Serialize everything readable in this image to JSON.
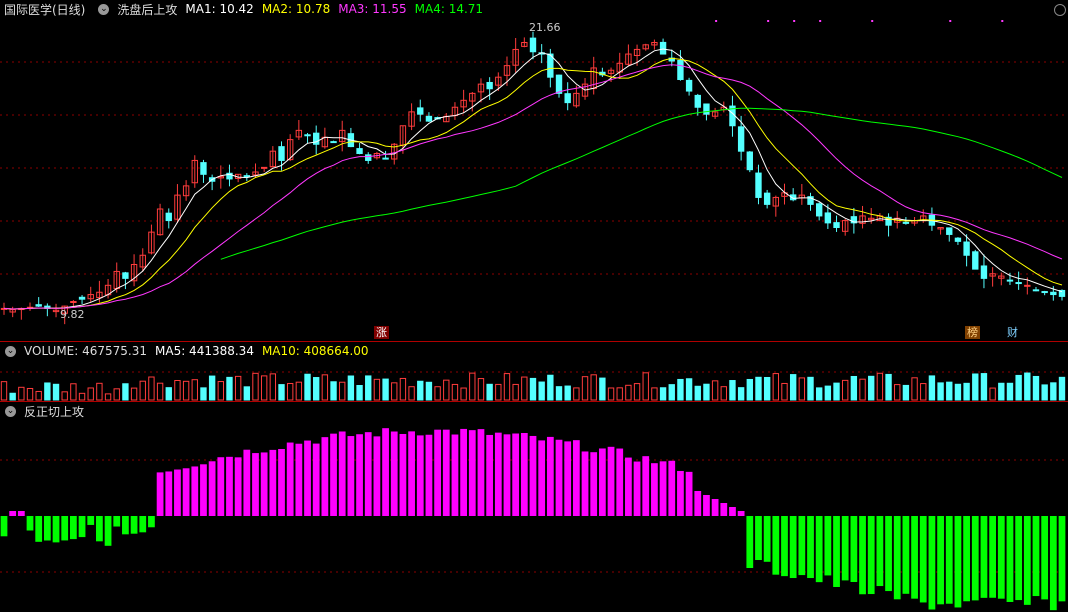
{
  "main_header": {
    "stock": "国际医学(日线)",
    "indicator": "洗盘后上攻",
    "ma1": "MA1: 10.42",
    "ma2": "MA2: 10.78",
    "ma3": "MA3: 11.55",
    "ma4": "MA4: 14.71"
  },
  "main_annotations": {
    "high": "21.66",
    "low": "9.82"
  },
  "markers": {
    "zhang": "涨",
    "bang": "榜",
    "cai": "财"
  },
  "volume_header": {
    "volume": "VOLUME: 467575.31",
    "ma5": "MA5: 441388.34",
    "ma10": "MA10: 408664.00"
  },
  "oscillator_header": {
    "name": "反正切上攻"
  },
  "colors": {
    "up": "#ff3c3c",
    "down": "#54ffff",
    "ma1": "#ffffff",
    "ma2": "#ffff00",
    "ma3": "#ff38ff",
    "ma4": "#00ff00",
    "pos": "#ff00ff",
    "neg": "#00ff00",
    "grid": "#8b0000"
  },
  "chart_data": {
    "type": "candlestick",
    "title": "国际医学(日线)",
    "price_anchors": {
      "high": 21.66,
      "low": 9.82
    },
    "close_path": [
      9.9,
      9.85,
      9.9,
      9.95,
      10.0,
      9.9,
      9.82,
      10.0,
      10.2,
      10.3,
      10.5,
      10.6,
      10.9,
      11.5,
      11.2,
      11.8,
      12.2,
      13.2,
      14.2,
      13.7,
      14.8,
      15.2,
      16.3,
      15.7,
      15.4,
      15.6,
      15.5,
      15.7,
      15.6,
      15.8,
      16.0,
      16.7,
      16.3,
      17.2,
      17.6,
      17.4,
      17.0,
      17.3,
      17.1,
      17.6,
      16.9,
      16.6,
      16.3,
      16.6,
      16.4,
      17.0,
      17.8,
      18.4,
      18.3,
      18.0,
      18.1,
      18.2,
      18.6,
      18.9,
      19.2,
      19.6,
      19.4,
      19.9,
      20.4,
      21.1,
      21.4,
      21.0,
      20.9,
      19.9,
      19.2,
      18.8,
      19.2,
      19.6,
      20.3,
      20.0,
      20.2,
      20.5,
      20.9,
      21.1,
      21.3,
      21.4,
      20.9,
      20.6,
      19.8,
      19.3,
      18.6,
      18.3,
      18.4,
      18.6,
      17.8,
      16.7,
      15.9,
      14.7,
      14.4,
      14.7,
      14.9,
      14.6,
      14.8,
      14.4,
      13.9,
      13.6,
      13.4,
      13.7,
      13.6,
      13.9,
      13.8,
      13.9,
      13.5,
      13.8,
      13.6,
      13.7,
      13.9,
      13.5,
      13.4,
      13.1,
      12.8,
      12.2,
      11.6,
      11.2,
      11.4,
      11.3,
      11.1,
      11.0,
      10.9,
      10.7,
      10.6,
      10.5,
      10.42
    ],
    "ma_values": {
      "MA1": 10.42,
      "MA2": 10.78,
      "MA3": 11.55,
      "MA4": 14.71
    },
    "volume": {
      "last": 467575.31,
      "MA5": 441388.34,
      "MA10": 408664.0
    },
    "oscillator_name": "反正切上攻"
  }
}
